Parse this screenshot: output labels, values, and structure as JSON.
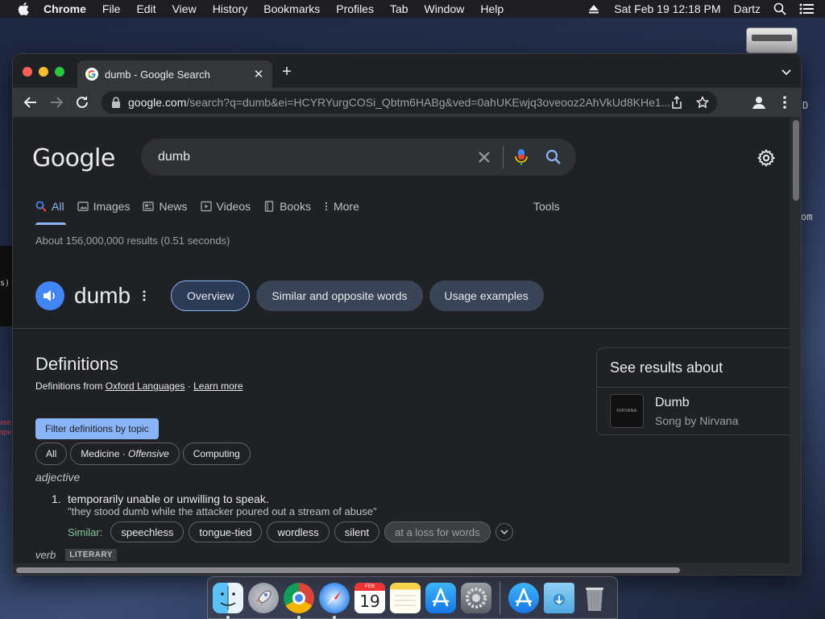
{
  "menubar": {
    "app": "Chrome",
    "items": [
      "File",
      "Edit",
      "View",
      "History",
      "Bookmarks",
      "Profiles",
      "Tab",
      "Window",
      "Help"
    ],
    "datetime": "Sat Feb 19  12:18 PM",
    "user": "Dartz"
  },
  "desktop": {
    "scrap_right1": "D",
    "scrap_right2": "om",
    "scrap_left1": "s)",
    "scrap_left2": "vse\nxpe"
  },
  "browser": {
    "tab_title": "dumb - Google Search",
    "url_domain": "google.com",
    "url_path": "/search?q=dumb&ei=HCYRYurgCOSi_Qbtm6HABg&ved=0ahUKEwjq3oveooz2AhVkUd8KHe1..."
  },
  "google": {
    "logo": "Google",
    "query": "dumb",
    "nav_tabs": [
      "All",
      "Images",
      "News",
      "Videos",
      "Books",
      "More"
    ],
    "tools": "Tools",
    "stats": "About 156,000,000 results (0.51 seconds)",
    "word": "dumb",
    "word_pills": [
      "Overview",
      "Similar and opposite words",
      "Usage examples"
    ],
    "definitions_heading": "Definitions",
    "definitions_from_prefix": "Definitions from ",
    "oxford": "Oxford Languages",
    "dot_sep": " · ",
    "learn_more": "Learn more",
    "filter_button": "Filter definitions by topic",
    "chips": {
      "all": "All",
      "medicine": "Medicine",
      "offensive": "Offensive",
      "computing": "Computing"
    },
    "pos1": "adjective",
    "sense1_num": "1.",
    "sense1_text": "temporarily unable or unwilling to speak.",
    "sense1_example": "\"they stood dumb while the attacker poured out a stream of abuse\"",
    "similar_label": "Similar:",
    "similar": [
      "speechless",
      "tongue-tied",
      "wordless",
      "silent",
      "at a loss for words"
    ],
    "pos2": "verb",
    "pos2_tag": "LITERARY",
    "kp_heading": "See results about",
    "kp_title": "Dumb",
    "kp_subtitle": "Song by Nirvana",
    "kp_thumb_text": "NIRVANA"
  },
  "colors": {
    "accent_blue": "#8ab4f8",
    "similar_green": "#81c995",
    "page_bg": "#202124"
  }
}
